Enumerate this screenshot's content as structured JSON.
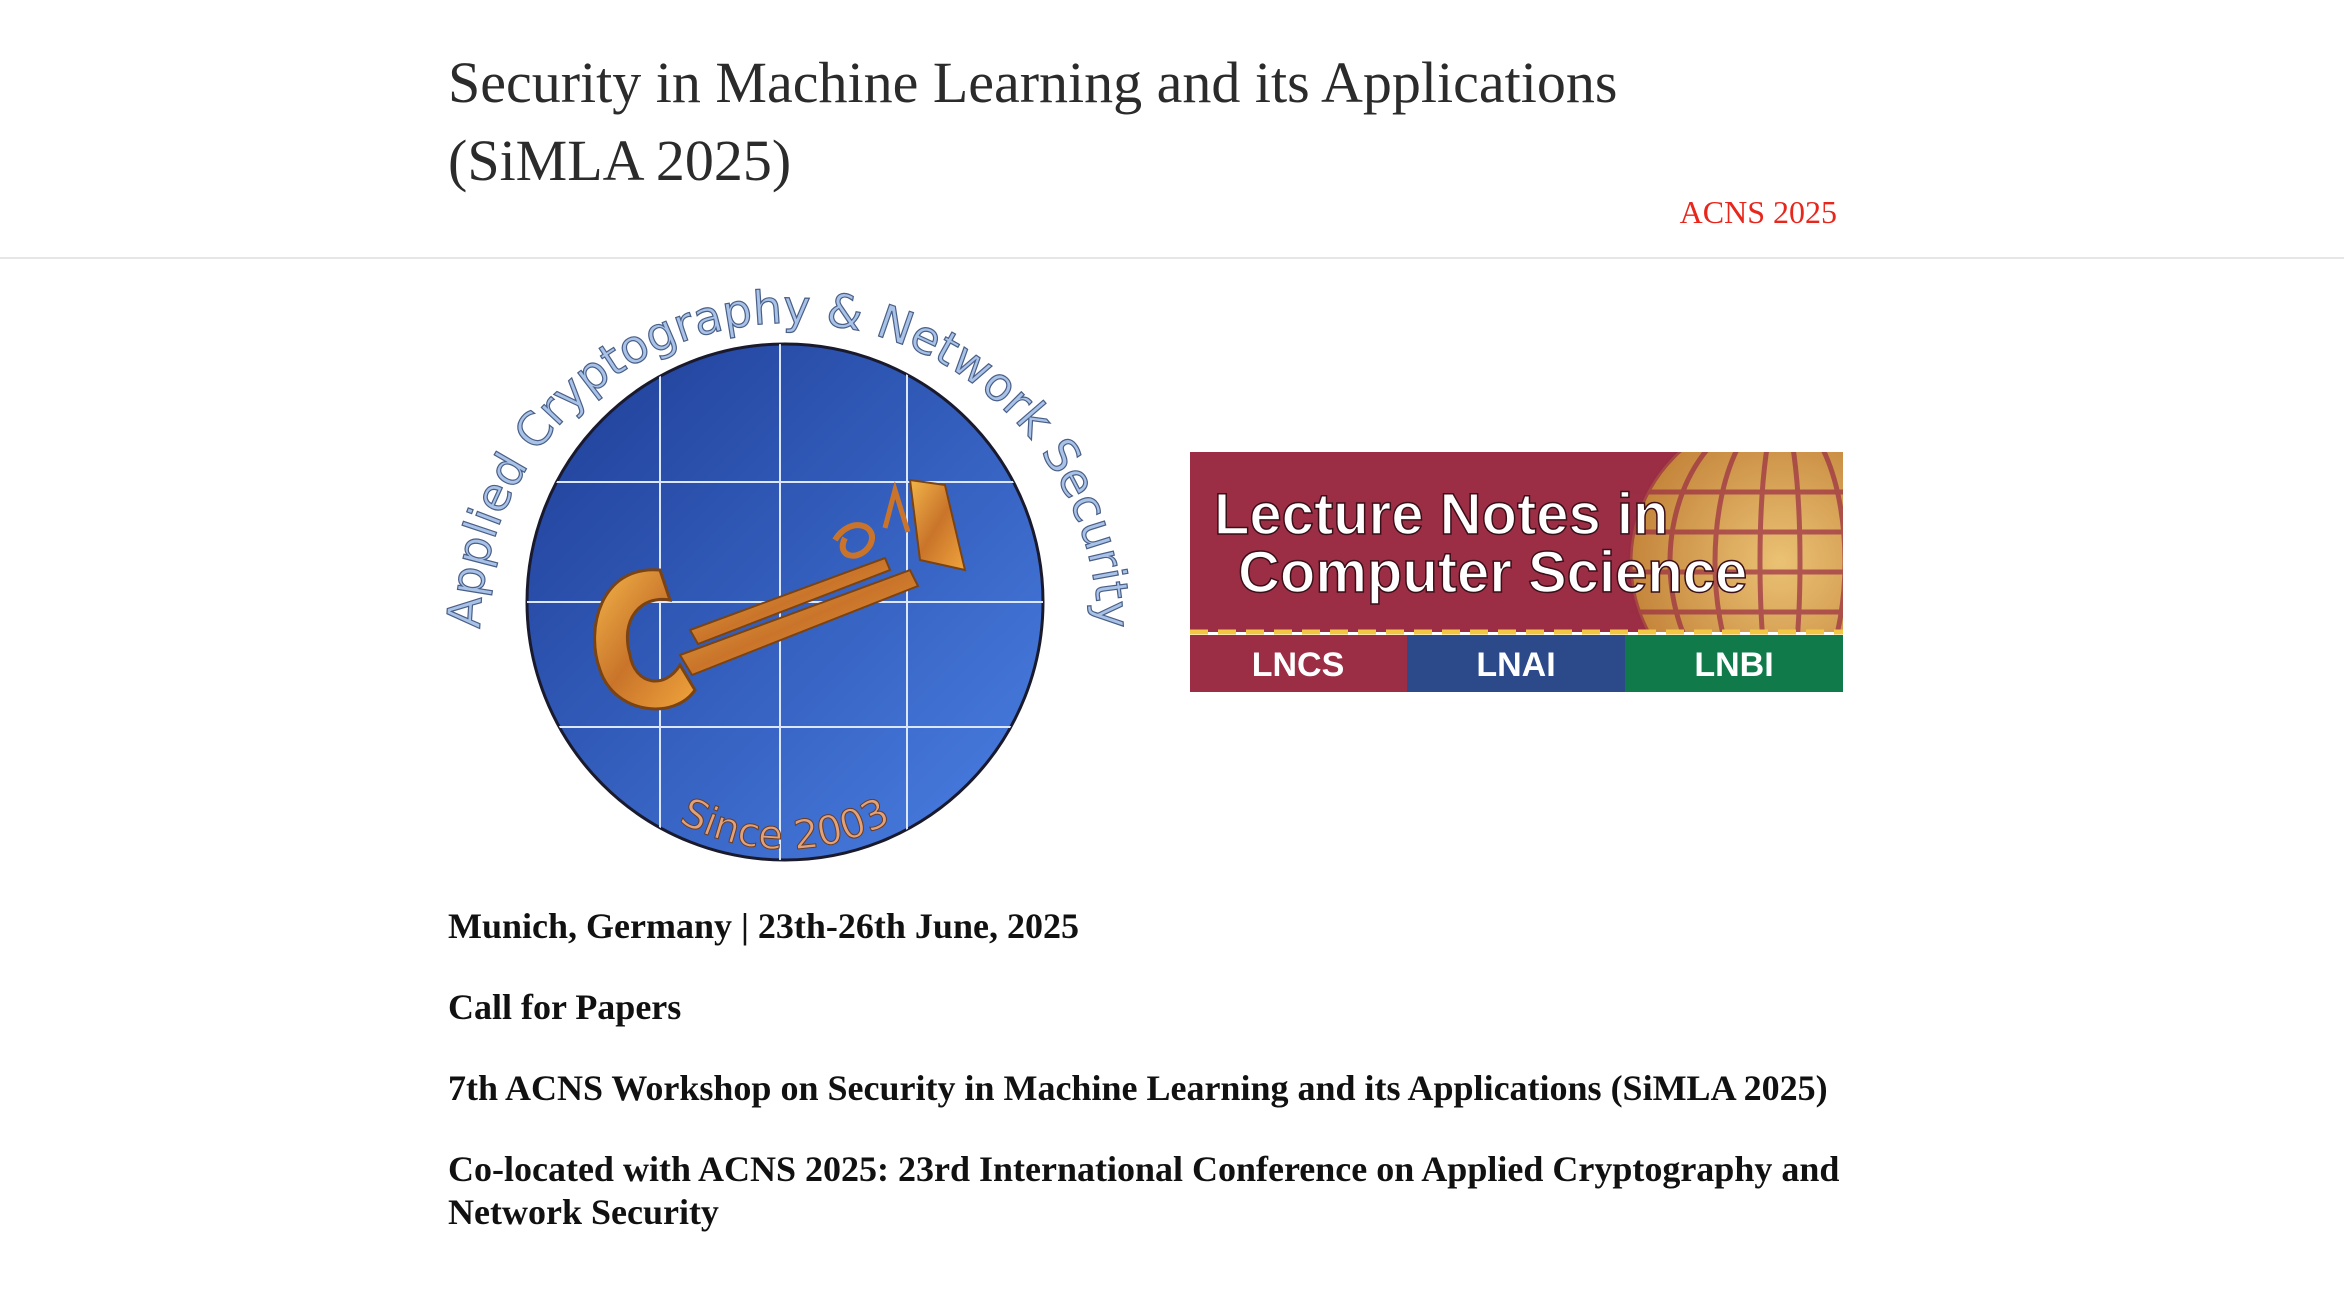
{
  "header": {
    "title": "Security in Machine Learning and its Applications (SiMLA 2025)",
    "nav_link": "ACNS 2025"
  },
  "logo": {
    "arc_text": "Applied Cryptography & Network Security",
    "since_text": "Since 2003"
  },
  "banner": {
    "line1": "Lecture Notes in",
    "line2": "Computer Science",
    "series": [
      "LNCS",
      "LNAI",
      "LNBI"
    ]
  },
  "content": {
    "location_date": "Munich, Germany | 23th-26th June, 2025",
    "call_for_papers": "Call for Papers",
    "workshop_title": "7th ACNS Workshop on Security in Machine Learning and its Applications (SiMLA 2025)",
    "colocated": "Co-located with ACNS 2025: 23rd International Conference on Applied Cryptography and Network Security"
  },
  "colors": {
    "nav_link": "#e8261c",
    "banner_red": "#9b2e45",
    "banner_blue": "#2c4a8a",
    "banner_green": "#117a4a",
    "logo_blue": "#2f5fc4"
  }
}
